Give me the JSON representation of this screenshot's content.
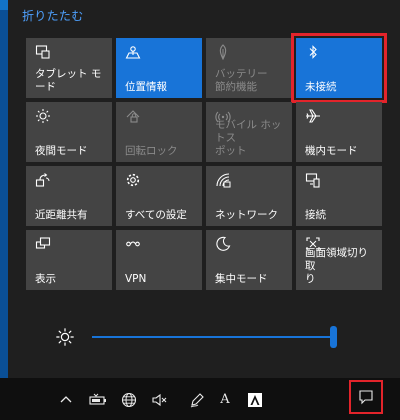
{
  "header": {
    "collapse_label": "折りたたむ"
  },
  "tiles": [
    {
      "label": "タブレット モード",
      "state": "off",
      "icon": "tablet-mode-icon"
    },
    {
      "label": "位置情報",
      "state": "on",
      "icon": "location-icon"
    },
    {
      "label": "バッテリー\n節約機能",
      "state": "disabled",
      "icon": "battery-saver-icon"
    },
    {
      "label": "未接続",
      "state": "on",
      "icon": "bluetooth-icon",
      "highlighted": true
    },
    {
      "label": "夜間モード",
      "state": "off",
      "icon": "night-light-icon"
    },
    {
      "label": "回転ロック",
      "state": "disabled",
      "icon": "rotation-lock-icon"
    },
    {
      "label": "モバイル ホットス\nポット",
      "state": "disabled",
      "icon": "mobile-hotspot-icon"
    },
    {
      "label": "機内モード",
      "state": "off",
      "icon": "airplane-icon"
    },
    {
      "label": "近距離共有",
      "state": "off",
      "icon": "nearby-sharing-icon"
    },
    {
      "label": "すべての設定",
      "state": "off",
      "icon": "settings-gear-icon"
    },
    {
      "label": "ネットワーク",
      "state": "off",
      "icon": "network-icon"
    },
    {
      "label": "接続",
      "state": "off",
      "icon": "connect-icon"
    },
    {
      "label": "表示",
      "state": "off",
      "icon": "project-icon"
    },
    {
      "label": "VPN",
      "state": "off",
      "icon": "vpn-icon"
    },
    {
      "label": "集中モード",
      "state": "off",
      "icon": "focus-assist-icon"
    },
    {
      "label": "画面領域切り取\nり",
      "state": "off",
      "icon": "screen-snip-icon"
    }
  ],
  "brightness": {
    "level": 1.0
  },
  "taskbar": {
    "icons": [
      "chevron-up-icon",
      "battery-icon",
      "globe-icon",
      "volume-mute-icon",
      "pen-icon",
      "ime-icon",
      "acrobat-icon",
      "action-center-icon"
    ],
    "ime_label": "A"
  },
  "colors": {
    "accent": "#1874d8",
    "tile": "#444444",
    "highlight": "#e3242b"
  }
}
